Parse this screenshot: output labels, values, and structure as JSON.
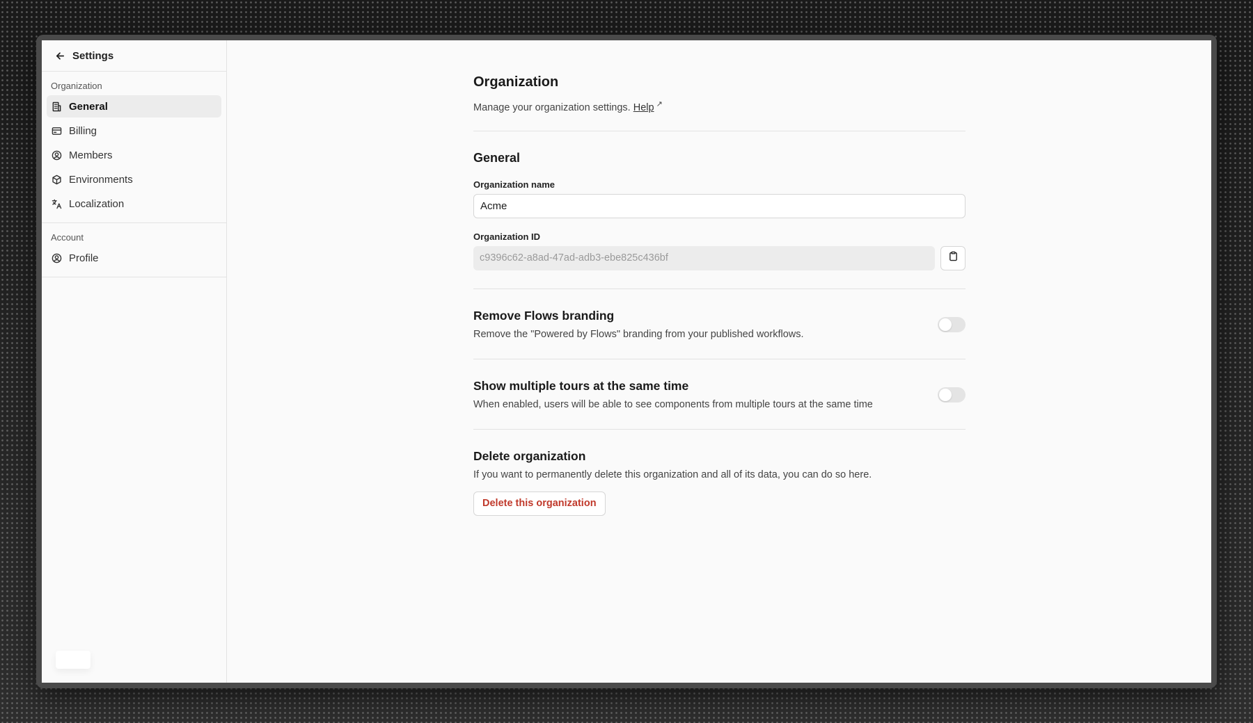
{
  "sidebar": {
    "header_title": "Settings",
    "sections": [
      {
        "label": "Organization",
        "items": [
          {
            "label": "General",
            "icon": "building-icon",
            "active": true
          },
          {
            "label": "Billing",
            "icon": "credit-card-icon",
            "active": false
          },
          {
            "label": "Members",
            "icon": "user-circle-icon",
            "active": false
          },
          {
            "label": "Environments",
            "icon": "cube-icon",
            "active": false
          },
          {
            "label": "Localization",
            "icon": "translate-icon",
            "active": false
          }
        ]
      },
      {
        "label": "Account",
        "items": [
          {
            "label": "Profile",
            "icon": "user-circle-icon",
            "active": false
          }
        ]
      }
    ]
  },
  "main": {
    "title": "Organization",
    "subtitle": "Manage your organization settings.",
    "help_label": "Help",
    "help_arrow": "↗",
    "general": {
      "title": "General",
      "org_name_label": "Organization name",
      "org_name_value": "Acme",
      "org_id_label": "Organization ID",
      "org_id_value": "c9396c62-a8ad-47ad-adb3-ebe825c436bf"
    },
    "branding": {
      "title": "Remove Flows branding",
      "description": "Remove the \"Powered by Flows\" branding from your published workflows.",
      "enabled": false
    },
    "tours": {
      "title": "Show multiple tours at the same time",
      "description": "When enabled, users will be able to see components from multiple tours at the same time",
      "enabled": false
    },
    "delete": {
      "title": "Delete organization",
      "description": "If you want to permanently delete this organization and all of its data, you can do so here.",
      "button_label": "Delete this organization"
    }
  },
  "colors": {
    "danger": "#c0392b",
    "active_nav_bg": "#ececec",
    "page_bg": "#fafafa"
  }
}
